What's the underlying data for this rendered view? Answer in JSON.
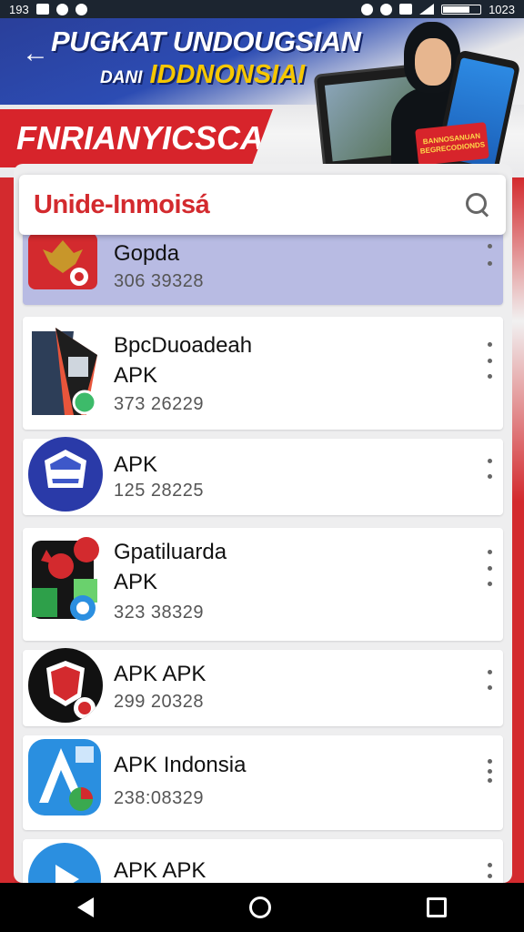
{
  "status_bar": {
    "left_text": "193",
    "time": "1023"
  },
  "banner": {
    "title_line1": "PUGKAT UNDOUGSIAN",
    "title_line2_prefix": "DANI",
    "title_line2": "IDDNONSIAI",
    "tag": "FNRIANYICSCANIIA",
    "badge": "BANNOSANUAN BEGRECODIONDS"
  },
  "search": {
    "value": "Unide-Inmoisá"
  },
  "apps": [
    {
      "name": "Gopda",
      "size": "306 39328",
      "selected": true
    },
    {
      "name": "BpcDuoadeah\nAPK",
      "size": "373 26229",
      "selected": false
    },
    {
      "name": "APK",
      "size": "125 28225",
      "selected": false
    },
    {
      "name": "Gpatiluarda\nAPK",
      "size": "323 38329",
      "selected": false
    },
    {
      "name": "APK APK",
      "size": "299 20328",
      "selected": false
    },
    {
      "name": "APK Indonsia",
      "size": "238:08329",
      "selected": false
    },
    {
      "name": "APK APK",
      "size": "",
      "selected": false
    }
  ],
  "colors": {
    "accent_red": "#d32a2e",
    "selected_row": "#b8bbe3",
    "banner_blue": "#2c4cb3"
  }
}
